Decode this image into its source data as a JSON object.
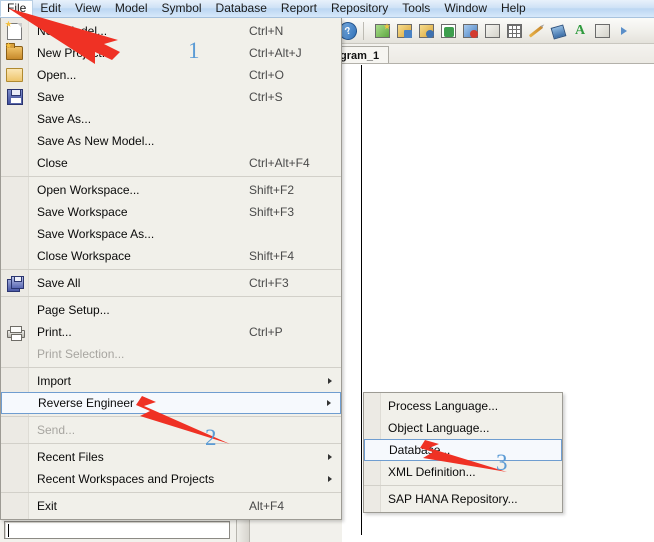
{
  "menubar": {
    "items": [
      {
        "label": "File",
        "active": true
      },
      {
        "label": "Edit",
        "active": false
      },
      {
        "label": "View",
        "active": false
      },
      {
        "label": "Model",
        "active": false
      },
      {
        "label": "Symbol",
        "active": false
      },
      {
        "label": "Database",
        "active": false
      },
      {
        "label": "Report",
        "active": false
      },
      {
        "label": "Repository",
        "active": false
      },
      {
        "label": "Tools",
        "active": false
      },
      {
        "label": "Window",
        "active": false
      },
      {
        "label": "Help",
        "active": false
      }
    ]
  },
  "toolbar": {
    "icons": [
      "help-circle-icon",
      "new-diagram-icon",
      "package-icon",
      "folder-search-icon",
      "refresh-icon",
      "check-document-icon",
      "rectangle-shape-icon",
      "grid-icon",
      "pencil-icon",
      "fill-bucket-icon",
      "font-color-icon",
      "export-icon",
      "next-arrow-icon"
    ]
  },
  "tab": {
    "label": "gram_1"
  },
  "file_menu": {
    "groups": [
      {
        "items": [
          {
            "label": "New Model...",
            "accel": "Ctrl+N",
            "icon": "new-model-icon",
            "arrow": false,
            "disabled": false,
            "highlight": false
          },
          {
            "label": "New Project...",
            "accel": "Ctrl+Alt+J",
            "icon": "new-project-icon",
            "arrow": false,
            "disabled": false,
            "highlight": false
          },
          {
            "label": "Open...",
            "accel": "Ctrl+O",
            "icon": "open-folder-icon",
            "arrow": false,
            "disabled": false,
            "highlight": false
          },
          {
            "label": "Save",
            "accel": "Ctrl+S",
            "icon": "save-floppy-icon",
            "arrow": false,
            "disabled": false,
            "highlight": false
          },
          {
            "label": "Save As...",
            "accel": "",
            "icon": "",
            "arrow": false,
            "disabled": false,
            "highlight": false
          },
          {
            "label": "Save As New Model...",
            "accel": "",
            "icon": "",
            "arrow": false,
            "disabled": false,
            "highlight": false
          },
          {
            "label": "Close",
            "accel": "Ctrl+Alt+F4",
            "icon": "",
            "arrow": false,
            "disabled": false,
            "highlight": false
          }
        ]
      },
      {
        "items": [
          {
            "label": "Open Workspace...",
            "accel": "Shift+F2",
            "icon": "",
            "arrow": false,
            "disabled": false,
            "highlight": false
          },
          {
            "label": "Save Workspace",
            "accel": "Shift+F3",
            "icon": "",
            "arrow": false,
            "disabled": false,
            "highlight": false
          },
          {
            "label": "Save Workspace As...",
            "accel": "",
            "icon": "",
            "arrow": false,
            "disabled": false,
            "highlight": false
          },
          {
            "label": "Close Workspace",
            "accel": "Shift+F4",
            "icon": "",
            "arrow": false,
            "disabled": false,
            "highlight": false
          }
        ]
      },
      {
        "items": [
          {
            "label": "Save All",
            "accel": "Ctrl+F3",
            "icon": "save-all-icon",
            "arrow": false,
            "disabled": false,
            "highlight": false
          }
        ]
      },
      {
        "items": [
          {
            "label": "Page Setup...",
            "accel": "",
            "icon": "",
            "arrow": false,
            "disabled": false,
            "highlight": false
          },
          {
            "label": "Print...",
            "accel": "Ctrl+P",
            "icon": "printer-icon",
            "arrow": false,
            "disabled": false,
            "highlight": false
          },
          {
            "label": "Print Selection...",
            "accel": "",
            "icon": "",
            "arrow": false,
            "disabled": true,
            "highlight": false
          }
        ]
      },
      {
        "items": [
          {
            "label": "Import",
            "accel": "",
            "icon": "",
            "arrow": true,
            "disabled": false,
            "highlight": false
          },
          {
            "label": "Reverse Engineer",
            "accel": "",
            "icon": "",
            "arrow": true,
            "disabled": false,
            "highlight": true
          }
        ]
      },
      {
        "items": [
          {
            "label": "Send...",
            "accel": "",
            "icon": "",
            "arrow": false,
            "disabled": true,
            "highlight": false
          }
        ]
      },
      {
        "items": [
          {
            "label": "Recent Files",
            "accel": "",
            "icon": "",
            "arrow": true,
            "disabled": false,
            "highlight": false
          },
          {
            "label": "Recent Workspaces and Projects",
            "accel": "",
            "icon": "",
            "arrow": true,
            "disabled": false,
            "highlight": false
          }
        ]
      },
      {
        "items": [
          {
            "label": "Exit",
            "accel": "Alt+F4",
            "icon": "",
            "arrow": false,
            "disabled": false,
            "highlight": false
          }
        ]
      }
    ]
  },
  "submenu": {
    "groups": [
      {
        "items": [
          {
            "label": "Process Language...",
            "highlight": false
          },
          {
            "label": "Object Language...",
            "highlight": false
          },
          {
            "label": "Database...",
            "highlight": true
          },
          {
            "label": "XML Definition...",
            "highlight": false
          }
        ]
      },
      {
        "items": [
          {
            "label": "SAP HANA Repository...",
            "highlight": false
          }
        ]
      }
    ]
  },
  "annotations": {
    "arrow_color": "#ef3124",
    "number_color": "#5b9bd5",
    "steps": [
      {
        "number": "1",
        "target": "file-menu-title"
      },
      {
        "number": "2",
        "target": "reverse-engineer-item"
      },
      {
        "number": "3",
        "target": "database-item"
      }
    ]
  }
}
